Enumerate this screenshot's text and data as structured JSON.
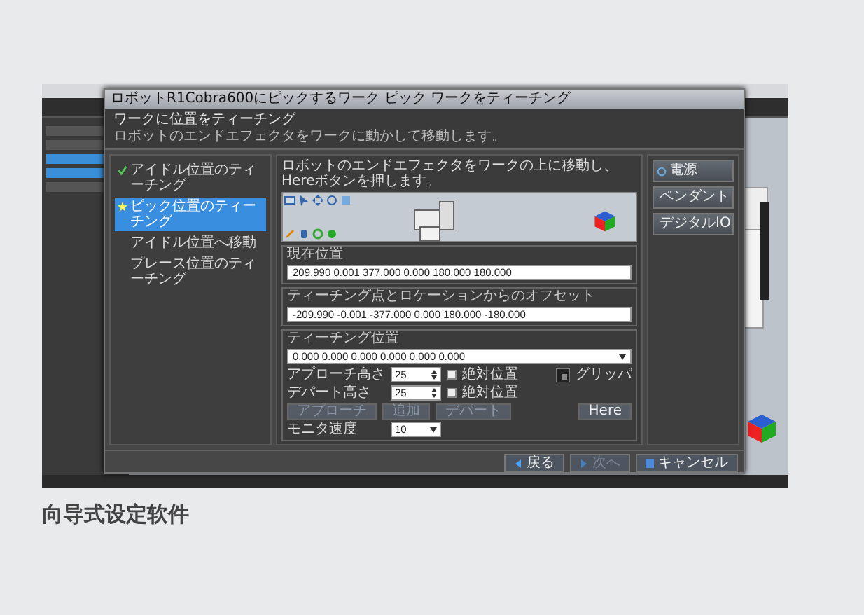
{
  "dialog": {
    "title": "ロボットR1Cobra600にピックするワーク ピック ワークをティーチング",
    "heading": "ワークに位置をティーチング",
    "subheading": "ロボットのエンドエフェクタをワークに動かして移動します。",
    "steps": [
      {
        "label": "アイドル位置のティーチング",
        "done": true,
        "selected": false
      },
      {
        "label": "ピック位置のティーチング",
        "done": false,
        "selected": true
      },
      {
        "label": "アイドル位置へ移動",
        "done": false,
        "selected": false
      },
      {
        "label": "プレース位置のティーチング",
        "done": false,
        "selected": false
      }
    ],
    "instruction": "ロボットのエンドエフェクタをワークの上に移動し、Hereボタンを押します。",
    "current_position": {
      "label": "現在位置",
      "value": "209.990 0.001 377.000 0.000 180.000 180.000"
    },
    "offset": {
      "label": "ティーチング点とロケーションからのオフセット",
      "value": "-209.990 -0.001 -377.000 0.000 180.000 -180.000"
    },
    "teach": {
      "label": "ティーチング位置",
      "value": "0.000 0.000 0.000 0.000 0.000 0.000",
      "rows": [
        {
          "label": "アプローチ高さ",
          "value": "25",
          "check_label": "絶対位置",
          "checked": false
        },
        {
          "label": "デパート高さ",
          "value": "25",
          "check_label": "絶対位置",
          "checked": false
        }
      ],
      "gripper_label": "グリッパ",
      "buttons": [
        {
          "label": "アプローチ",
          "disabled": true
        },
        {
          "label": "追加",
          "disabled": true
        },
        {
          "label": "デパート",
          "disabled": true
        }
      ],
      "here_button": "Here",
      "monitor": {
        "label": "モニタ速度",
        "value": "10"
      }
    },
    "side_buttons": [
      {
        "label": "電源",
        "kind": "power"
      },
      {
        "label": "ペンダント",
        "kind": "pendant"
      },
      {
        "label": "デジタルIO",
        "kind": "io"
      }
    ],
    "footer_buttons": [
      {
        "label": "戻る",
        "kind": "back",
        "disabled": false
      },
      {
        "label": "次へ",
        "kind": "next",
        "disabled": true
      },
      {
        "label": "キャンセル",
        "kind": "cancel",
        "disabled": false
      }
    ]
  },
  "caption": "向导式设定软件"
}
